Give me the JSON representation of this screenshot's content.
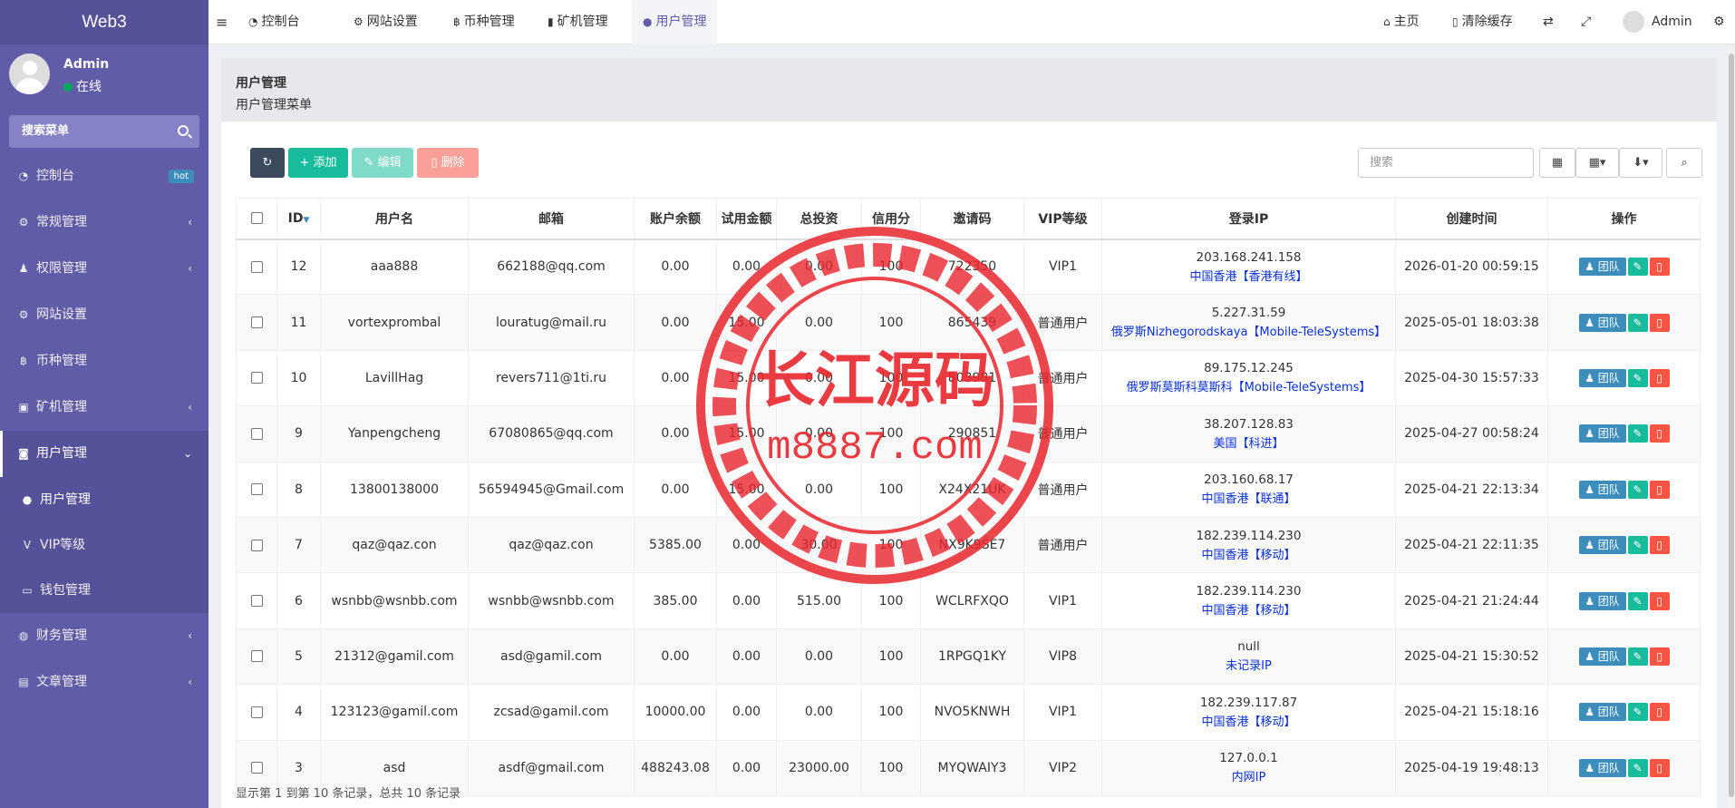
{
  "sidebar": {
    "brand": "Web3",
    "user": {
      "name": "Admin",
      "status": "在线"
    },
    "search_label": "搜索菜单",
    "items": [
      {
        "label": "控制台",
        "icon": "dashboard-icon",
        "badge": "hot"
      },
      {
        "label": "常规管理",
        "icon": "cogs-icon"
      },
      {
        "label": "权限管理",
        "icon": "group-icon"
      },
      {
        "label": "网站设置",
        "icon": "cogs-icon"
      },
      {
        "label": "币种管理",
        "icon": "bitcoin-icon"
      },
      {
        "label": "矿机管理",
        "icon": "cubes-icon"
      },
      {
        "label": "用户管理",
        "icon": "instagram-icon"
      },
      {
        "label": "财务管理",
        "icon": "globe-icon"
      },
      {
        "label": "文章管理",
        "icon": "book-icon"
      }
    ],
    "sub_items": [
      {
        "label": "用户管理",
        "icon": "user-icon"
      },
      {
        "label": "VIP等级",
        "icon": "vimeo-icon"
      },
      {
        "label": "钱包管理",
        "icon": "credit-card-icon"
      }
    ]
  },
  "topbar": {
    "tabs": [
      {
        "label": "控制台",
        "icon": "dashboard-icon"
      },
      {
        "label": "网站设置",
        "icon": "cogs-icon"
      },
      {
        "label": "币种管理",
        "icon": "bitcoin-icon"
      },
      {
        "label": "矿机管理",
        "icon": "cubes-icon"
      },
      {
        "label": "用户管理",
        "icon": "user-icon"
      }
    ],
    "right": {
      "home": "主页",
      "clear_cache": "清除缓存",
      "admin": "Admin"
    }
  },
  "content_header": {
    "title": "用户管理",
    "subtitle": "用户管理菜单"
  },
  "toolbar": {
    "add": "添加",
    "edit": "编辑",
    "delete": "删除",
    "search_placeholder": "搜索"
  },
  "table": {
    "columns": [
      "ID",
      "用户名",
      "邮箱",
      "账户余额",
      "试用金额",
      "总投资",
      "信用分",
      "邀请码",
      "VIP等级",
      "登录IP",
      "创建时间",
      "操作"
    ],
    "team_label": "团队",
    "rows": [
      {
        "id": "12",
        "username": "aaa888",
        "email": "662188@qq.com",
        "balance": "0.00",
        "trial": "0.00",
        "invest": "0.00",
        "credit": "100",
        "code": "722350",
        "vip": "VIP1",
        "ip": "203.168.241.158",
        "loc": "中国香港【香港有线】",
        "time": "2026-01-20 00:59:15"
      },
      {
        "id": "11",
        "username": "vortexprombal",
        "email": "louratug@mail.ru",
        "balance": "0.00",
        "trial": "15.00",
        "invest": "0.00",
        "credit": "100",
        "code": "865439",
        "vip": "普通用户",
        "ip": "5.227.31.59",
        "loc": "俄罗斯Nizhegorodskaya【Mobile-TeleSystems】",
        "time": "2025-05-01 18:03:38"
      },
      {
        "id": "10",
        "username": "LavillHag",
        "email": "revers711@1ti.ru",
        "balance": "0.00",
        "trial": "15.00",
        "invest": "0.00",
        "credit": "100",
        "code": "803981",
        "vip": "普通用户",
        "ip": "89.175.12.245",
        "loc": "俄罗斯莫斯科莫斯科【Mobile-TeleSystems】",
        "time": "2025-04-30 15:57:33"
      },
      {
        "id": "9",
        "username": "Yanpengcheng",
        "email": "67080865@qq.com",
        "balance": "0.00",
        "trial": "15.00",
        "invest": "0.00",
        "credit": "100",
        "code": "290851",
        "vip": "普通用户",
        "ip": "38.207.128.83",
        "loc": "美国【科进】",
        "time": "2025-04-27 00:58:24"
      },
      {
        "id": "8",
        "username": "13800138000",
        "email": "56594945@Gmail.com",
        "balance": "0.00",
        "trial": "15.00",
        "invest": "0.00",
        "credit": "100",
        "code": "X24X21UK",
        "vip": "普通用户",
        "ip": "203.160.68.17",
        "loc": "中国香港【联通】",
        "time": "2025-04-21 22:13:34"
      },
      {
        "id": "7",
        "username": "qaz@qaz.con",
        "email": "qaz@qaz.con",
        "balance": "5385.00",
        "trial": "0.00",
        "invest": "30.00",
        "credit": "100",
        "code": "NX9K9SE7",
        "vip": "普通用户",
        "ip": "182.239.114.230",
        "loc": "中国香港【移动】",
        "time": "2025-04-21 22:11:35"
      },
      {
        "id": "6",
        "username": "wsnbb@wsnbb.com",
        "email": "wsnbb@wsnbb.com",
        "balance": "385.00",
        "trial": "0.00",
        "invest": "515.00",
        "credit": "100",
        "code": "WCLRFXQO",
        "vip": "VIP1",
        "ip": "182.239.114.230",
        "loc": "中国香港【移动】",
        "time": "2025-04-21 21:24:44"
      },
      {
        "id": "5",
        "username": "21312@gamil.com",
        "email": "asd@gamil.com",
        "balance": "0.00",
        "trial": "0.00",
        "invest": "0.00",
        "credit": "100",
        "code": "1RPGQ1KY",
        "vip": "VIP8",
        "ip": "null",
        "loc": "未记录IP",
        "time": "2025-04-21 15:30:52"
      },
      {
        "id": "4",
        "username": "123123@gamil.com",
        "email": "zcsad@gamil.com",
        "balance": "10000.00",
        "trial": "0.00",
        "invest": "0.00",
        "credit": "100",
        "code": "NVO5KNWH",
        "vip": "VIP1",
        "ip": "182.239.117.87",
        "loc": "中国香港【移动】",
        "time": "2025-04-21 15:18:16"
      },
      {
        "id": "3",
        "username": "asd",
        "email": "asdf@gmail.com",
        "balance": "488243.08",
        "trial": "0.00",
        "invest": "23000.00",
        "credit": "100",
        "code": "MYQWAIY3",
        "vip": "VIP2",
        "ip": "127.0.0.1",
        "loc": "内网IP",
        "time": "2025-04-19 19:48:13"
      }
    ]
  },
  "pagination_info": "显示第 1 到第 10 条记录，总共 10 条记录",
  "watermark": {
    "text_cn": "长江源码",
    "text_url": "m8887.com",
    "color": "#e8262d"
  },
  "colors": {
    "sidebar": "#605ca8",
    "accent": "#3c8dbc",
    "success": "#18bc9c",
    "danger": "#f75444"
  }
}
